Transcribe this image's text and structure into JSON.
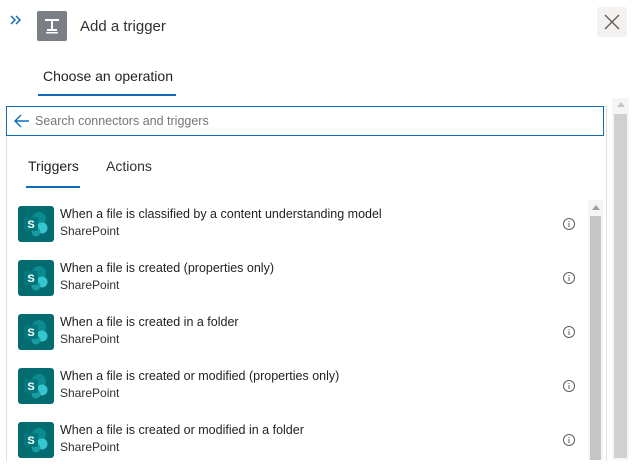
{
  "header": {
    "title": "Add a trigger",
    "expand_icon": "double-chevron-right-icon",
    "trigger_icon": "trigger-icon",
    "close_icon": "close-icon"
  },
  "operation_tab": {
    "label": "Choose an operation"
  },
  "search": {
    "placeholder": "Search connectors and triggers",
    "value": "",
    "icon": "back-arrow-icon"
  },
  "tabs": [
    {
      "label": "Triggers",
      "selected": true
    },
    {
      "label": "Actions",
      "selected": false
    }
  ],
  "triggers": [
    {
      "title": "When a file is classified by a content understanding model",
      "connector": "SharePoint"
    },
    {
      "title": "When a file is created (properties only)",
      "connector": "SharePoint"
    },
    {
      "title": "When a file is created in a folder",
      "connector": "SharePoint"
    },
    {
      "title": "When a file is created or modified (properties only)",
      "connector": "SharePoint"
    },
    {
      "title": "When a file is created or modified in a folder",
      "connector": "SharePoint"
    }
  ],
  "colors": {
    "accent": "#0f6cbd",
    "sharepoint": "#036c70",
    "trigger_icon_bg": "#7a7f86"
  }
}
